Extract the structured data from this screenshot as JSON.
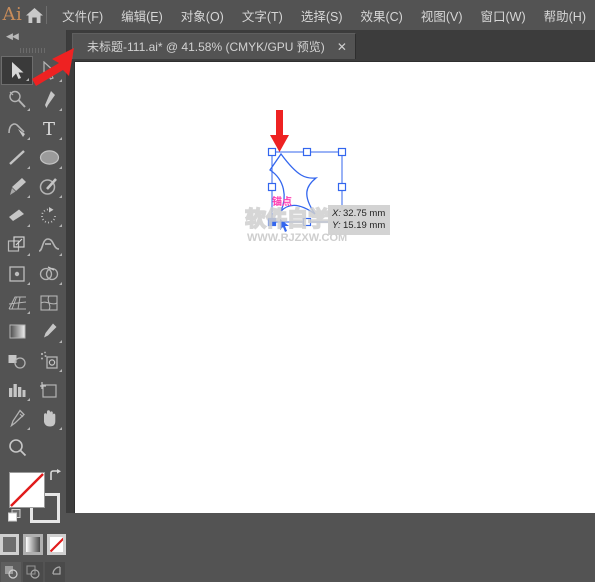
{
  "app": {
    "logo_text": "Ai",
    "home_icon": "home-icon"
  },
  "menubar": {
    "items": [
      {
        "label": "文件(F)",
        "name": "menu-file"
      },
      {
        "label": "编辑(E)",
        "name": "menu-edit"
      },
      {
        "label": "对象(O)",
        "name": "menu-object"
      },
      {
        "label": "文字(T)",
        "name": "menu-type"
      },
      {
        "label": "选择(S)",
        "name": "menu-select"
      },
      {
        "label": "效果(C)",
        "name": "menu-effect"
      },
      {
        "label": "视图(V)",
        "name": "menu-view"
      },
      {
        "label": "窗口(W)",
        "name": "menu-window"
      },
      {
        "label": "帮助(H)",
        "name": "menu-help"
      }
    ]
  },
  "tabbar": {
    "document_title": "未标题-111.ai* @ 41.58% (CMYK/GPU 预览)",
    "close_glyph": "✕"
  },
  "toolpanel": {
    "collapse_glyph": "◀◀",
    "tools": [
      {
        "name": "selection-tool",
        "active": true,
        "has_corner": true
      },
      {
        "name": "direct-selection-tool",
        "active": false,
        "has_corner": true
      },
      {
        "name": "magic-wand-tool",
        "active": false,
        "has_corner": true
      },
      {
        "name": "pen-tool",
        "active": false,
        "has_corner": true
      },
      {
        "name": "curvature-tool",
        "active": false,
        "has_corner": true
      },
      {
        "name": "type-tool",
        "active": false,
        "has_corner": true
      },
      {
        "name": "line-segment-tool",
        "active": false,
        "has_corner": true
      },
      {
        "name": "ellipse-tool",
        "active": false,
        "has_corner": true
      },
      {
        "name": "paintbrush-tool",
        "active": false,
        "has_corner": true
      },
      {
        "name": "shaper-tool",
        "active": false,
        "has_corner": true
      },
      {
        "name": "eraser-tool",
        "active": false,
        "has_corner": true
      },
      {
        "name": "rotate-tool",
        "active": false,
        "has_corner": true
      },
      {
        "name": "scale-tool",
        "active": false,
        "has_corner": true
      },
      {
        "name": "width-tool",
        "active": false,
        "has_corner": true
      },
      {
        "name": "free-transform-tool",
        "active": false,
        "has_corner": true
      },
      {
        "name": "shape-builder-tool",
        "active": false,
        "has_corner": true
      },
      {
        "name": "perspective-grid-tool",
        "active": false,
        "has_corner": true
      },
      {
        "name": "mesh-tool",
        "active": false,
        "has_corner": false
      },
      {
        "name": "gradient-tool",
        "active": false,
        "has_corner": false
      },
      {
        "name": "eyedropper-tool",
        "active": false,
        "has_corner": true
      },
      {
        "name": "blend-tool",
        "active": false,
        "has_corner": false
      },
      {
        "name": "symbol-sprayer-tool",
        "active": false,
        "has_corner": true
      },
      {
        "name": "column-graph-tool",
        "active": false,
        "has_corner": true
      },
      {
        "name": "artboard-tool",
        "active": false,
        "has_corner": false
      },
      {
        "name": "slice-tool",
        "active": false,
        "has_corner": true
      },
      {
        "name": "hand-tool",
        "active": false,
        "has_corner": true
      },
      {
        "name": "zoom-tool",
        "active": false,
        "has_corner": false
      }
    ],
    "colors": {
      "fill": "#ffffff",
      "stroke_none_slash": "#e01b1b",
      "swap_glyph": "↰"
    },
    "mode_buttons": [
      {
        "name": "color-mode-solid"
      },
      {
        "name": "color-mode-gradient"
      },
      {
        "name": "color-mode-none"
      }
    ],
    "draw_buttons": [
      {
        "name": "draw-normal-button"
      },
      {
        "name": "draw-behind-button"
      },
      {
        "name": "draw-inside-button"
      }
    ]
  },
  "canvas": {
    "background": "#3c3c3c",
    "artboard_color": "#ffffff",
    "selection_color": "#2255ee",
    "annotation_arrow_color": "#ee2222",
    "anchor_label": "锚点",
    "measure_tooltip": {
      "x_axis_label": "X:",
      "x_value": "32.75 mm",
      "y_axis_label": "Y:",
      "y_value": "15.19 mm"
    },
    "watermark": {
      "line1": "软件自学网",
      "line2": "WWW.RJZXW.COM"
    }
  }
}
